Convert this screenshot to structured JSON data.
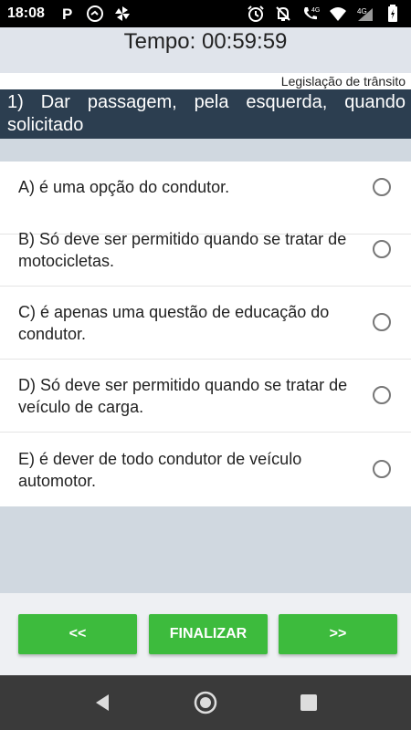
{
  "status_bar": {
    "time": "18:08",
    "left_icons": [
      "parking-icon",
      "clock-speed-icon",
      "pinwheel-icon"
    ],
    "right_icons": [
      "alarm-icon",
      "notifications-off-icon",
      "wifi-call-icon",
      "wifi-icon",
      "signal-4g-icon",
      "battery-icon"
    ],
    "network": "4G"
  },
  "timer": {
    "text": "Tempo: 00:59:59"
  },
  "category": {
    "text": "Legislação de trânsito"
  },
  "question": {
    "text": "1) Dar passagem, pela esquerda, quando solicitado"
  },
  "options": [
    {
      "label": "A) é uma opção do condutor."
    },
    {
      "label": "B) Só deve ser permitido quando se tratar de motocicletas."
    },
    {
      "label": "C) é apenas uma questão de educação do condutor."
    },
    {
      "label": "D) Só deve ser permitido quando se tratar de veículo de carga."
    },
    {
      "label": "E) é dever de todo condutor de veículo automotor."
    }
  ],
  "footer": {
    "prev_label": "<<",
    "finish_label": "FINALIZAR",
    "next_label": ">>",
    "button_color": "#3dbb3d"
  },
  "nav_bar": {
    "icons": [
      "back-icon",
      "home-icon",
      "recents-icon"
    ]
  }
}
